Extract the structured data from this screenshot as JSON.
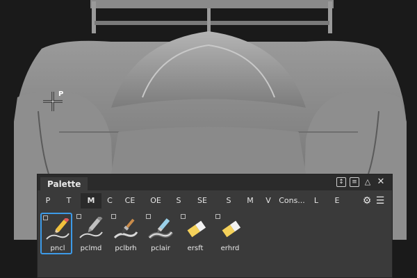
{
  "viewport": {
    "cursor_label": "P"
  },
  "palette": {
    "tab_label": "Palette",
    "title_controls": [
      "updown-box-icon",
      "menu-box-icon",
      "collapse-icon",
      "close-icon"
    ],
    "categories": [
      "P",
      "T",
      "M",
      "C",
      "CE",
      "OE",
      "S",
      "SE",
      "S",
      "M",
      "V",
      "Cons...",
      "L",
      "E"
    ],
    "active_category": "M",
    "category_icons": [
      "gear-icon",
      "hamburger-icon"
    ],
    "tools": [
      {
        "label": "pncl",
        "icon": "pencil-icon",
        "selected": true
      },
      {
        "label": "pclmd",
        "icon": "pencil-medium-icon",
        "selected": false
      },
      {
        "label": "pclbrh",
        "icon": "brush-icon",
        "selected": false
      },
      {
        "label": "pclair",
        "icon": "airbrush-icon",
        "selected": false
      },
      {
        "label": "ersft",
        "icon": "eraser-soft-icon",
        "selected": false
      },
      {
        "label": "erhrd",
        "icon": "eraser-hard-icon",
        "selected": false
      }
    ]
  },
  "colors": {
    "selection": "#3d9be9",
    "panel_bg": "#3a3a3a",
    "titlebar_bg": "#2b2b2b"
  }
}
